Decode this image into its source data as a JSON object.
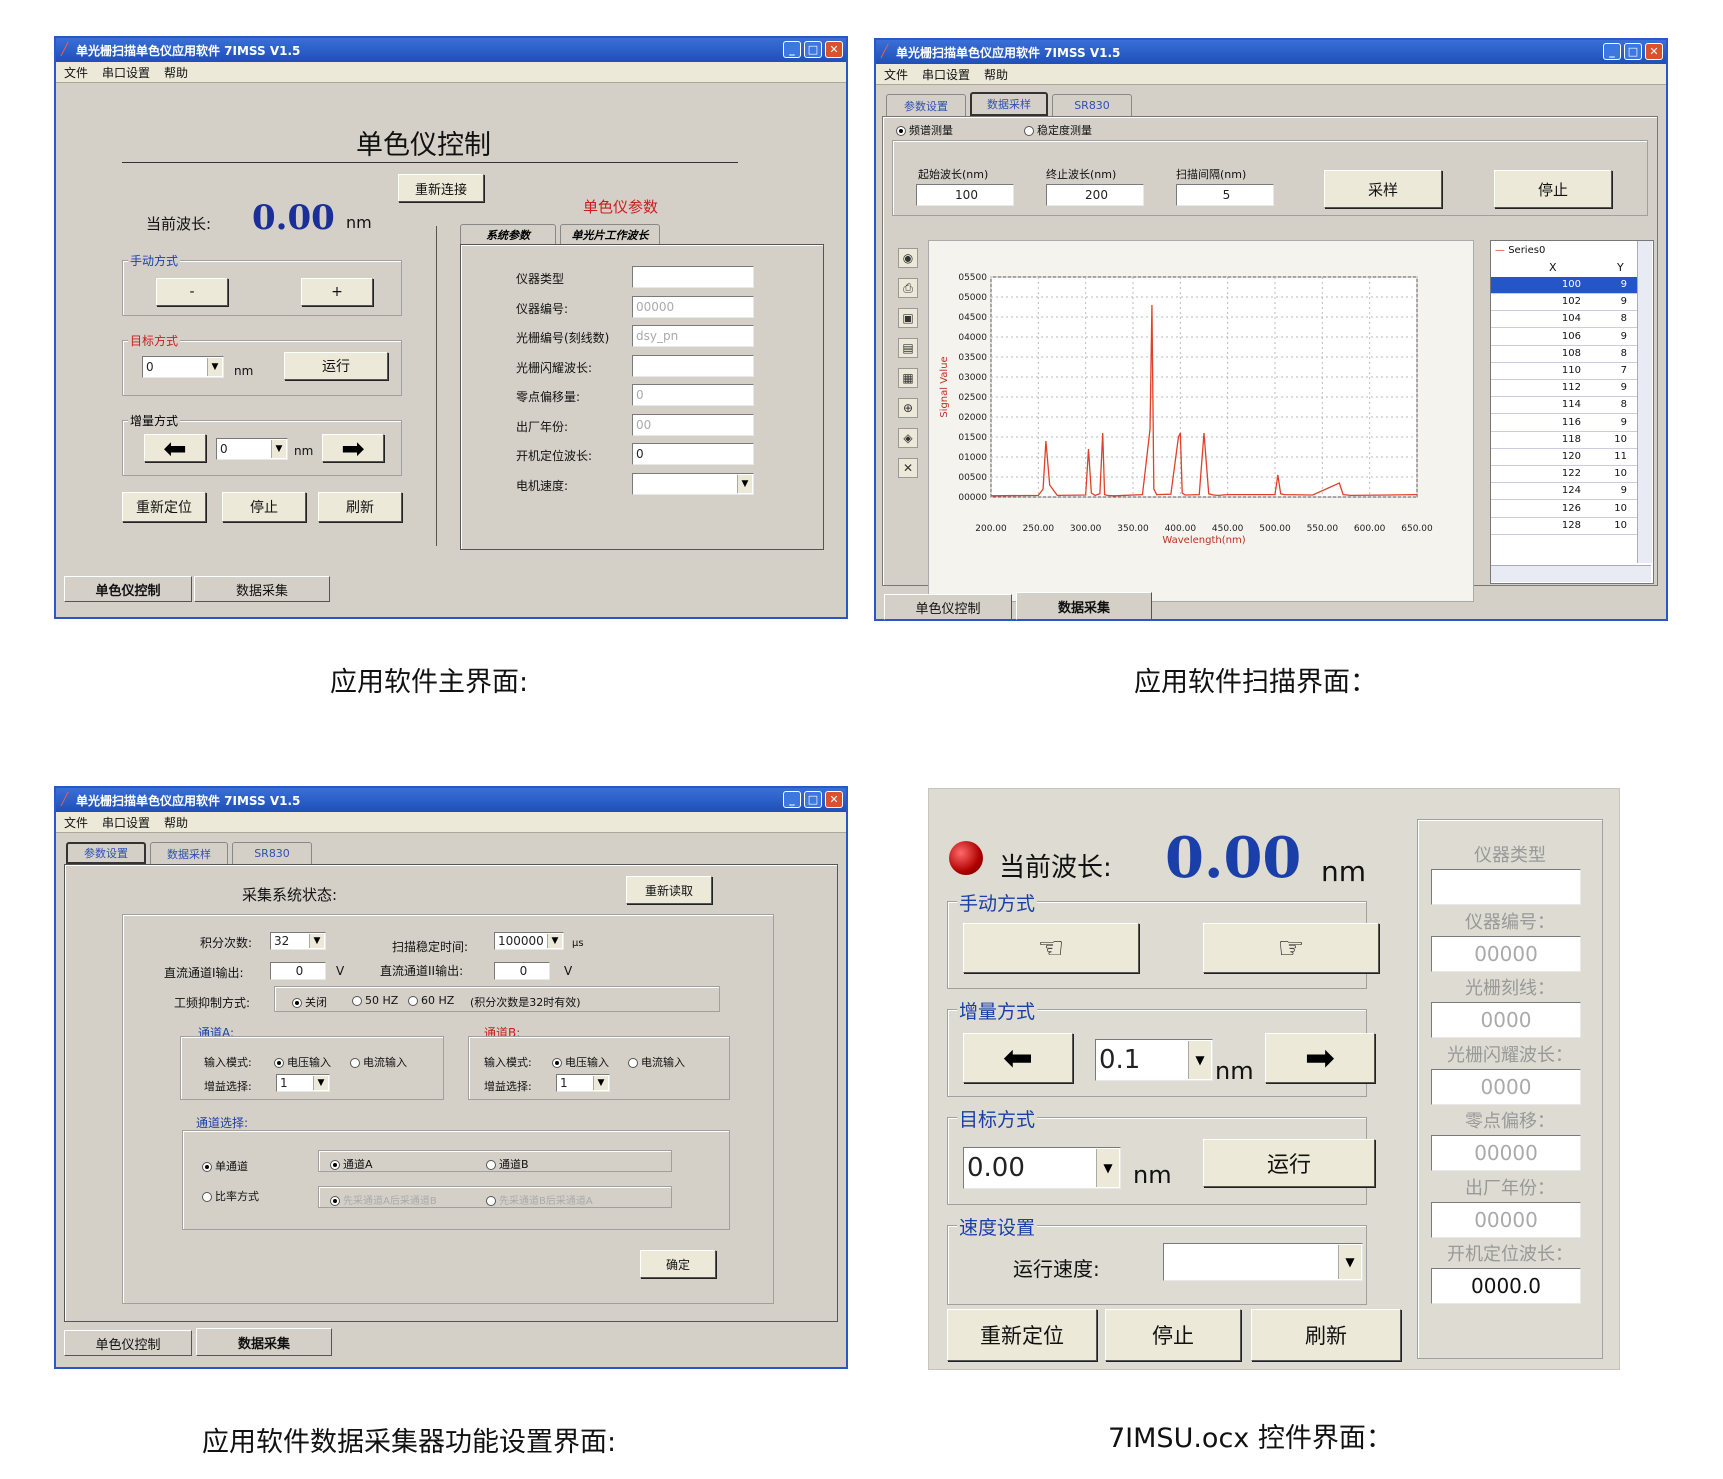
{
  "window_title": "单光栅扫描单色仪应用软件 7IMSS V1.5",
  "menu": [
    "文件",
    "串口设置",
    "帮助"
  ],
  "bottom_tabs": [
    "单色仪控制",
    "数据采集"
  ],
  "captions": {
    "main": "应用软件主界面:",
    "scan": "应用软件扫描界面：",
    "collector": "应用软件数据采集器功能设置界面:",
    "ocx": "7IMSU.ocx 控件界面："
  },
  "main_ui": {
    "heading": "单色仪控制",
    "reconnect": "重新连接",
    "params_title": "单色仪参数",
    "current_wavelength_label": "当前波长:",
    "current_wavelength_value": "0.00",
    "unit": "nm",
    "manual_mode": "手动方式",
    "minus": "-",
    "plus": "+",
    "target_mode": "目标方式",
    "target_value": "0",
    "run": "运行",
    "incr_mode": "增量方式",
    "incr_value": "0",
    "reposition": "重新定位",
    "stop": "停止",
    "refresh": "刷新",
    "param_tabs": [
      "系统参数",
      "单光片工作波长"
    ],
    "params": [
      {
        "label": "仪器类型",
        "value": ""
      },
      {
        "label": "仪器编号:",
        "value": "00000"
      },
      {
        "label": "光栅编号(刻线数)",
        "value": "dsy_pn"
      },
      {
        "label": "光栅闪耀波长:",
        "value": ""
      },
      {
        "label": "零点偏移量:",
        "value": "0"
      },
      {
        "label": "出厂年份:",
        "value": "00"
      },
      {
        "label": "开机定位波长:",
        "value": "0"
      },
      {
        "label": "电机速度:",
        "value": ""
      }
    ]
  },
  "scan_ui": {
    "tabs": [
      "参数设置",
      "数据采样",
      "SR830"
    ],
    "radio_continuous": "频谱测量",
    "radio_stability": "稳定度测量",
    "start_label": "起始波长(nm)",
    "start_value": "100",
    "end_label": "终止波长(nm)",
    "end_value": "200",
    "step_label": "扫描间隔(nm)",
    "step_value": "5",
    "sample": "采样",
    "stop": "停止",
    "series_name": "Series0",
    "table_headers": [
      "X",
      "Y"
    ],
    "table_rows": [
      [
        100,
        9
      ],
      [
        102,
        9
      ],
      [
        104,
        8
      ],
      [
        106,
        9
      ],
      [
        108,
        8
      ],
      [
        110,
        7
      ],
      [
        112,
        9
      ],
      [
        114,
        8
      ],
      [
        116,
        9
      ],
      [
        118,
        10
      ],
      [
        120,
        11
      ],
      [
        122,
        10
      ],
      [
        124,
        9
      ],
      [
        126,
        10
      ],
      [
        128,
        10
      ]
    ],
    "side_icons": [
      "camera-icon",
      "print-icon",
      "save-icon",
      "save-as-icon",
      "open-icon",
      "zoom-icon",
      "chart-icon",
      "clear-icon"
    ]
  },
  "chart_data": {
    "type": "line",
    "xlabel": "Wavelength(nm)",
    "ylabel": "Signal Value",
    "xlim": [
      200,
      650
    ],
    "ylim": [
      0,
      5500
    ],
    "xticks": [
      "200.00",
      "250.00",
      "300.00",
      "350.00",
      "400.00",
      "450.00",
      "500.00",
      "550.00",
      "600.00",
      "650.00"
    ],
    "yticks": [
      "00000",
      "00500",
      "01000",
      "01500",
      "02000",
      "02500",
      "03000",
      "03500",
      "04000",
      "04500",
      "05000",
      "05500"
    ],
    "series": [
      {
        "x": [
          200,
          250,
          255,
          258,
          262,
          270,
          300,
          303,
          306,
          310,
          315,
          318,
          320,
          323,
          330,
          360,
          368,
          370,
          372,
          375,
          390,
          398,
          400,
          402,
          405,
          420,
          425,
          430,
          435,
          440,
          450,
          500,
          503,
          506,
          510,
          540,
          568,
          570,
          572,
          580,
          620,
          650
        ],
        "y": [
          30,
          40,
          200,
          1400,
          300,
          40,
          50,
          1200,
          100,
          40,
          80,
          1600,
          60,
          40,
          30,
          60,
          1700,
          4800,
          200,
          60,
          70,
          1500,
          1600,
          100,
          50,
          60,
          1600,
          80,
          50,
          40,
          60,
          60,
          550,
          80,
          60,
          50,
          350,
          200,
          60,
          40,
          50,
          60
        ]
      }
    ]
  },
  "collector_ui": {
    "tabs": [
      "参数设置",
      "数据采样",
      "SR830"
    ],
    "status_label": "采集系统状态:",
    "reread": "重新读取",
    "integ_label": "积分次数:",
    "integ_value": "32",
    "scan_time_label": "扫描稳定时间:",
    "scan_time_value": "100000",
    "scan_time_unit": "μs",
    "dc1_label": "直流通道I输出:",
    "dc1_value": "0",
    "dc2_label": "直流通道II输出:",
    "dc2_value": "0",
    "volt_unit": "V",
    "power_label": "工频抑制方式:",
    "power_options": [
      "关闭",
      "50 HZ",
      "60 HZ"
    ],
    "power_note": "(积分次数是32时有效)",
    "channel_a": "通道A:",
    "channel_b": "通道B:",
    "input_mode": "输入模式:",
    "voltage_in": "电压输入",
    "current_in": "电流输入",
    "gain_label": "增益选择:",
    "gain_value": "1",
    "channel_select": "通道选择:",
    "single": "单通道",
    "ratio": "比率方式",
    "ch_a_opt": "通道A",
    "ch_b_opt": "通道B",
    "ratio_opt1": "先采通道A后采通道B",
    "ratio_opt2": "先采通道B后采通道A",
    "ok": "确定"
  },
  "ocx_ui": {
    "current_label": "当前波长:",
    "current_value": "0.00",
    "unit": "nm",
    "manual": "手动方式",
    "incr": "增量方式",
    "incr_value": "0.1",
    "target": "目标方式",
    "target_value": "0.00",
    "run": "运行",
    "speed": "速度设置",
    "speed_label": "运行速度:",
    "reposition": "重新定位",
    "stop": "停止",
    "refresh": "刷新",
    "params": [
      {
        "label": "仪器类型",
        "value": ""
      },
      {
        "label": "仪器编号：",
        "value": "00000"
      },
      {
        "label": "光栅刻线：",
        "value": "0000"
      },
      {
        "label": "光栅闪耀波长：",
        "value": "0000"
      },
      {
        "label": "零点偏移：",
        "value": "00000"
      },
      {
        "label": "出厂年份：",
        "value": "00000"
      },
      {
        "label": "开机定位波长：",
        "value": "0000.0"
      }
    ]
  }
}
